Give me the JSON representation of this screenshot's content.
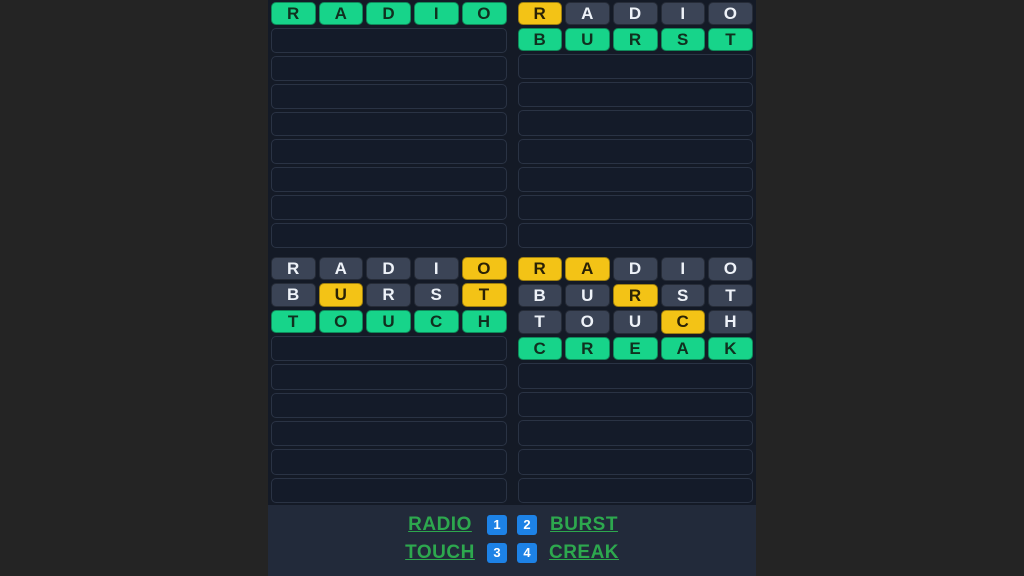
{
  "app": {
    "name": "quordle-board",
    "background": "#242424",
    "panel_background": "#141a26",
    "footer_background": "#222a3a"
  },
  "colors": {
    "correct": "#17d48a",
    "present": "#f3c316",
    "absent": "#3b4456",
    "empty": "#141b29",
    "badge": "#1d82e6",
    "answer_text": "#2da84e"
  },
  "boards": [
    {
      "id": 1,
      "name": "board-top-left",
      "rows_total": 9,
      "guesses": [
        {
          "letters": [
            "R",
            "A",
            "D",
            "I",
            "O"
          ],
          "states": [
            "correct",
            "correct",
            "correct",
            "correct",
            "correct"
          ]
        }
      ]
    },
    {
      "id": 2,
      "name": "board-top-right",
      "rows_total": 9,
      "guesses": [
        {
          "letters": [
            "R",
            "A",
            "D",
            "I",
            "O"
          ],
          "states": [
            "present",
            "absent",
            "absent",
            "absent",
            "absent"
          ]
        },
        {
          "letters": [
            "B",
            "U",
            "R",
            "S",
            "T"
          ],
          "states": [
            "correct",
            "correct",
            "correct",
            "correct",
            "correct"
          ]
        }
      ]
    },
    {
      "id": 3,
      "name": "board-bottom-left",
      "rows_total": 9,
      "guesses": [
        {
          "letters": [
            "R",
            "A",
            "D",
            "I",
            "O"
          ],
          "states": [
            "absent",
            "absent",
            "absent",
            "absent",
            "present"
          ]
        },
        {
          "letters": [
            "B",
            "U",
            "R",
            "S",
            "T"
          ],
          "states": [
            "absent",
            "present",
            "absent",
            "absent",
            "present"
          ]
        },
        {
          "letters": [
            "T",
            "O",
            "U",
            "C",
            "H"
          ],
          "states": [
            "correct",
            "correct",
            "correct",
            "correct",
            "correct"
          ]
        }
      ]
    },
    {
      "id": 4,
      "name": "board-bottom-right",
      "rows_total": 9,
      "guesses": [
        {
          "letters": [
            "R",
            "A",
            "D",
            "I",
            "O"
          ],
          "states": [
            "present",
            "present",
            "absent",
            "absent",
            "absent"
          ]
        },
        {
          "letters": [
            "B",
            "U",
            "R",
            "S",
            "T"
          ],
          "states": [
            "absent",
            "absent",
            "present",
            "absent",
            "absent"
          ]
        },
        {
          "letters": [
            "T",
            "O",
            "U",
            "C",
            "H"
          ],
          "states": [
            "absent",
            "absent",
            "absent",
            "present",
            "absent"
          ]
        },
        {
          "letters": [
            "C",
            "R",
            "E",
            "A",
            "K"
          ],
          "states": [
            "correct",
            "correct",
            "correct",
            "correct",
            "correct"
          ]
        }
      ]
    }
  ],
  "footer": {
    "rows": [
      {
        "left_word": "RADIO",
        "left_badge": "1",
        "right_badge": "2",
        "right_word": "BURST"
      },
      {
        "left_word": "TOUCH",
        "left_badge": "3",
        "right_badge": "4",
        "right_word": "CREAK"
      }
    ]
  }
}
